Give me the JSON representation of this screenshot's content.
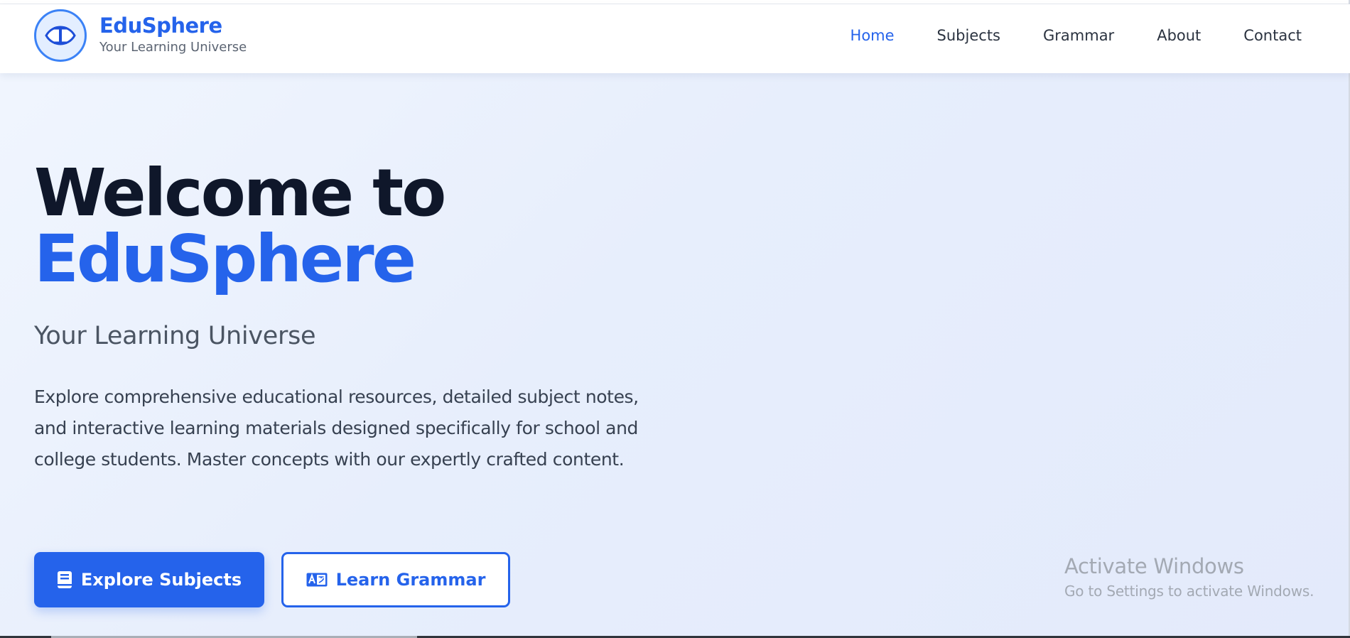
{
  "brand": {
    "name": "EduSphere",
    "tagline": "Your Learning Universe",
    "logo_icon": "edusphere-logo-icon",
    "color": "#2563eb"
  },
  "nav": {
    "items": [
      {
        "label": "Home",
        "active": true
      },
      {
        "label": "Subjects",
        "active": false
      },
      {
        "label": "Grammar",
        "active": false
      },
      {
        "label": "About",
        "active": false
      },
      {
        "label": "Contact",
        "active": false
      }
    ]
  },
  "hero": {
    "title_line1": "Welcome to",
    "title_line2": "EduSphere",
    "subtitle": "Your Learning Universe",
    "description": "Explore comprehensive educational resources, detailed subject notes, and interactive learning materials designed specifically for school and college students. Master concepts with our expertly crafted content."
  },
  "buttons": {
    "primary": {
      "label": "Explore Subjects",
      "icon": "book-icon"
    },
    "secondary": {
      "label": "Learn Grammar",
      "icon": "language-icon"
    }
  },
  "watermark": {
    "title": "Activate Windows",
    "subtitle": "Go to Settings to activate Windows."
  },
  "colors": {
    "accent": "#2563eb",
    "heading": "#0f172a",
    "body_text": "#374151",
    "hero_bg_start": "#f1f6fe",
    "hero_bg_end": "#e3eafb"
  }
}
